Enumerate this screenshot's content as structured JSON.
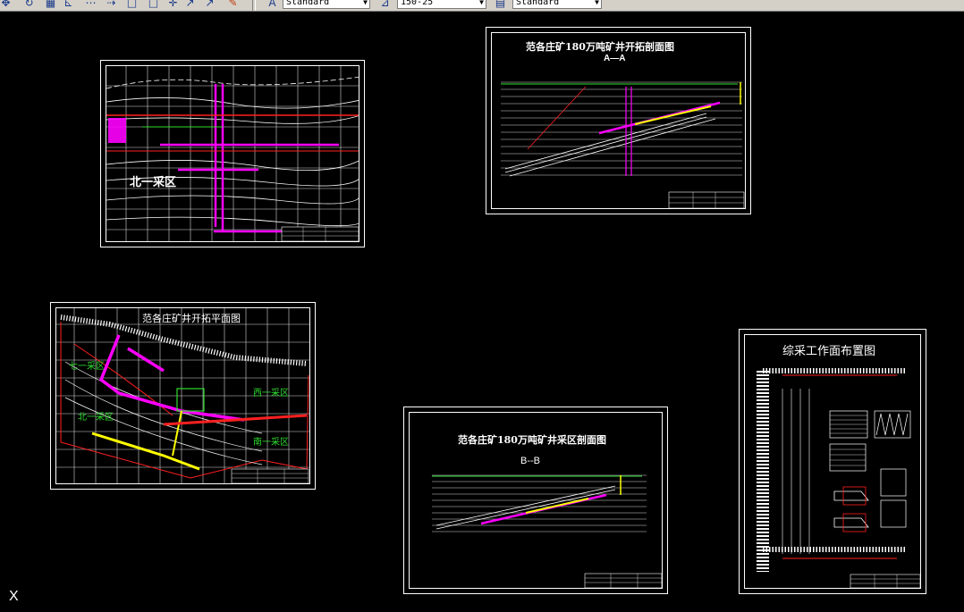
{
  "toolbar": {
    "text_style": "Standard",
    "dim_scale": "150-25",
    "table_style": "Standard",
    "icons": [
      "pan-icon",
      "orbit-icon",
      "grid-icon",
      "ruler-icon",
      "dimension-icon",
      "arrow-icon",
      "square-icon",
      "square-icon",
      "move-icon",
      "pointer-icon",
      "pointer-icon",
      "paint-icon",
      "palette-icon",
      "dimension-style-icon",
      "table-style-icon"
    ]
  },
  "sheets": {
    "plan_north": {
      "label": "北一采区"
    },
    "section_aa": {
      "title": "范各庄矿180万吨矿井开拓剖面图",
      "section": "A—A"
    },
    "plan_overview": {
      "title": "范各庄矿井开拓平面图",
      "labels": [
        "七一采区",
        "北一采区",
        "西一采区",
        "南一采区"
      ]
    },
    "section_bb": {
      "title": "范各庄矿180万吨矿井采区剖面图",
      "section": "B--B"
    },
    "face_layout": {
      "title": "综采工作面布置图"
    }
  },
  "ucs_label": "X",
  "colors": {
    "background": "#000000",
    "line": "#ffffff",
    "magenta": "#ff00ff",
    "yellow": "#ffff00",
    "red": "#ff2020",
    "green": "#2fdc2f"
  }
}
